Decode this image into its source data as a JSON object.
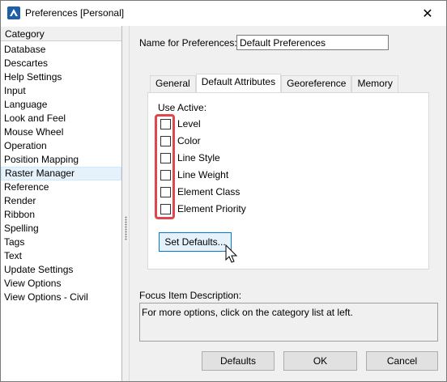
{
  "window": {
    "title": "Preferences [Personal]",
    "close_symbol": "✕"
  },
  "category": {
    "header": "Category",
    "items": [
      "Database",
      "Descartes",
      "Help Settings",
      "Input",
      "Language",
      "Look and Feel",
      "Mouse Wheel",
      "Operation",
      "Position Mapping",
      "Raster Manager",
      "Reference",
      "Render",
      "Ribbon",
      "Spelling",
      "Tags",
      "Text",
      "Update Settings",
      "View Options",
      "View Options - Civil"
    ],
    "selected": "Raster Manager"
  },
  "name_field": {
    "label": "Name for Preferences:",
    "value": "Default Preferences"
  },
  "tabs": [
    {
      "label": "General",
      "active": false
    },
    {
      "label": "Default Attributes",
      "active": true
    },
    {
      "label": "Georeference",
      "active": false
    },
    {
      "label": "Memory",
      "active": false
    }
  ],
  "default_attributes": {
    "use_active_label": "Use Active:",
    "checkboxes": [
      {
        "label": "Level",
        "checked": false
      },
      {
        "label": "Color",
        "checked": false
      },
      {
        "label": "Line Style",
        "checked": false
      },
      {
        "label": "Line Weight",
        "checked": false
      },
      {
        "label": "Element Class",
        "checked": false
      },
      {
        "label": "Element Priority",
        "checked": false
      }
    ],
    "set_defaults_button": "Set Defaults..."
  },
  "focus": {
    "label": "Focus Item Description:",
    "text": "For more options, click on the category list at left."
  },
  "buttons": {
    "defaults": "Defaults",
    "ok": "OK",
    "cancel": "Cancel"
  },
  "colors": {
    "highlight": "#e0474c",
    "accent": "#0078d7",
    "selection": "#e5f1fb"
  },
  "icons": {
    "app": "microstation-app-icon",
    "close": "close-icon",
    "cursor": "mouse-pointer-icon"
  }
}
